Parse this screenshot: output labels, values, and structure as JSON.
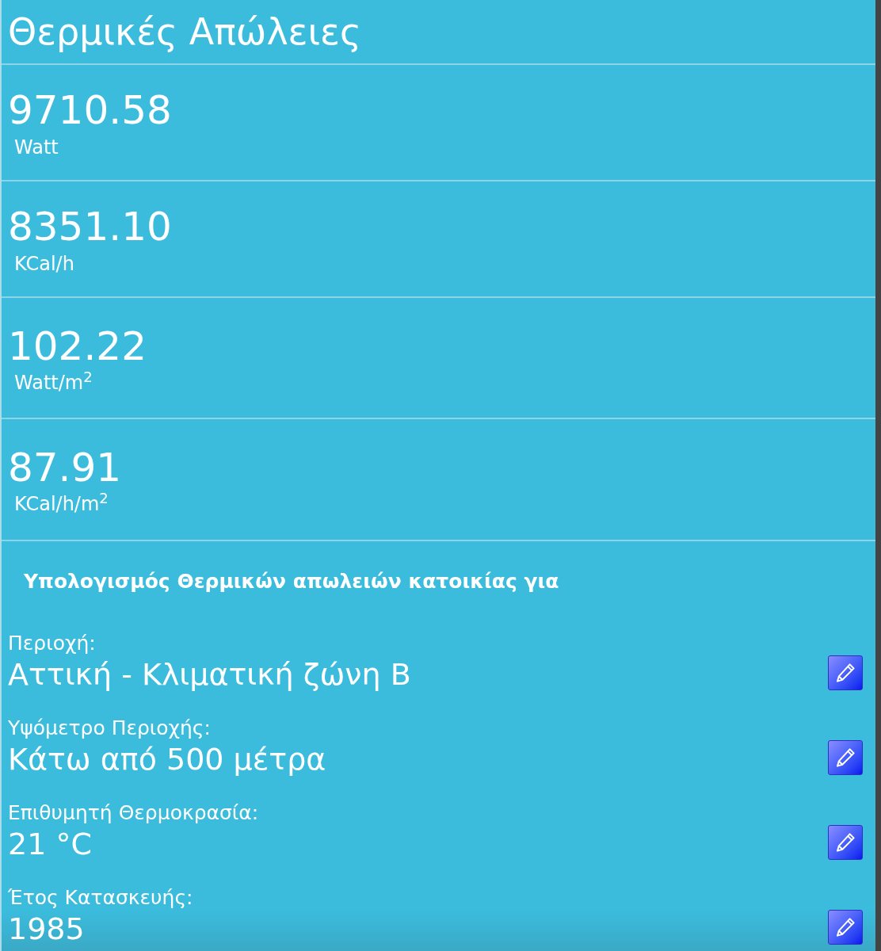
{
  "title": "Θερμικές Απώλειες",
  "results": [
    {
      "value": "9710.58",
      "unit": "Watt"
    },
    {
      "value": "8351.10",
      "unit": "KCal/h"
    },
    {
      "value": "102.22",
      "unit": "Watt/m$^{2}$"
    },
    {
      "value": "87.91",
      "unit": "KCal/h/m$^{2}$"
    }
  ],
  "section_heading": "Υπολογισμός Θερμικών απωλειών κατοικίας για",
  "parameters": [
    {
      "label": "Περιοχή:",
      "value": "Αττική - Κλιματική ζώνη Β"
    },
    {
      "label": "Υψόμετρο Περιοχής:",
      "value": "Κάτω από 500 μέτρα"
    },
    {
      "label": "Επιθυμητή Θερμοκρασία:",
      "value": "21 °C"
    },
    {
      "label": "Έτος Κατασκευής:",
      "value": "1985"
    }
  ]
}
